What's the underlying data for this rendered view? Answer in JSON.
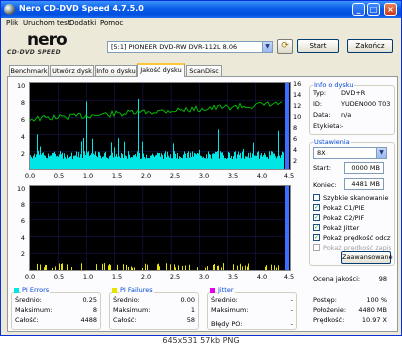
{
  "window": {
    "title": "Nero CD-DVD Speed 4.7.5.0"
  },
  "menu": [
    "Plik",
    "Uruchom test",
    "Dodatki",
    "Pomoc"
  ],
  "logo": {
    "main": "nero",
    "sub": "CD·DVD SPEED"
  },
  "toolbar": {
    "drive": "[5:1]  PIONEER DVD-RW  DVR-112L 8.06",
    "start": "Start",
    "stop": "Zakończ"
  },
  "tabs": [
    "Benchmark",
    "Utwórz dysk",
    "Info o dysku",
    "Jakość dysku",
    "ScanDisc"
  ],
  "charts": {
    "top": {
      "y_left": [
        "10",
        "8",
        "6",
        "4",
        "2"
      ],
      "y_right": [
        "16",
        "14",
        "12",
        "10",
        "8",
        "6",
        "4",
        "2"
      ],
      "x": [
        "0.0",
        "0.5",
        "1.0",
        "1.5",
        "2.0",
        "2.5",
        "3.0",
        "3.5",
        "4.0",
        "4.5"
      ]
    },
    "bottom": {
      "y_left": [
        "10",
        "8",
        "6",
        "4",
        "2"
      ],
      "x": [
        "0.0",
        "0.5",
        "1.0",
        "1.5",
        "2.0",
        "2.5",
        "3.0",
        "3.5",
        "4.0",
        "4.5"
      ]
    }
  },
  "disc_info": {
    "title": "Info o dysku",
    "rows": [
      {
        "label": "Typ:",
        "value": "DVD+R"
      },
      {
        "label": "ID:",
        "value": "YUDEN000 T03"
      },
      {
        "label": "Data:",
        "value": "n/a"
      },
      {
        "label": "Etykieta:",
        "value": "-"
      }
    ]
  },
  "settings": {
    "title": "Ustawienia",
    "speed": "8X",
    "start_label": "Start:",
    "start_value": "0000 MB",
    "end_label": "Koniec:",
    "end_value": "4481 MB",
    "checks": [
      {
        "label": "Szybkie skanowanie",
        "checked": false
      },
      {
        "label": "Pokaż C1/PIE",
        "checked": true
      },
      {
        "label": "Pokaż C2/PIF",
        "checked": true
      },
      {
        "label": "Pokaż Jitter",
        "checked": true
      },
      {
        "label": "Pokaż prędkość odczytu",
        "checked": true
      },
      {
        "label": "Pokaż prędkość zapisu",
        "checked": false
      }
    ],
    "advanced": "Zaawansowane"
  },
  "quality": {
    "label": "Ocena jakości:",
    "value": "98"
  },
  "pi_errors": {
    "title": "PI Errors",
    "color": "#00e5e5",
    "avg_label": "Średnio:",
    "avg": "0.25",
    "max_label": "Maksimum:",
    "max": "8",
    "total_label": "Całość:",
    "total": "4488"
  },
  "pi_failures": {
    "title": "PI Failures",
    "color": "#e5e500",
    "avg_label": "Średnio:",
    "avg": "0.00",
    "max_label": "Maksimum:",
    "max": "1",
    "total_label": "Całość:",
    "total": "58"
  },
  "jitter": {
    "title": "Jitter",
    "color": "#e500e5",
    "avg_label": "Średnio:",
    "avg": "-",
    "max_label": "Maksimum:",
    "max": "-",
    "po_label": "Błędy PO:",
    "po": "-"
  },
  "progress": {
    "progress_label": "Postęp:",
    "progress": "100 %",
    "position_label": "Położenie:",
    "position": "4480 MB",
    "speed_label": "Prędkość:",
    "speed": "10.97 X"
  },
  "caption": "645x531  57kb  PNG"
}
